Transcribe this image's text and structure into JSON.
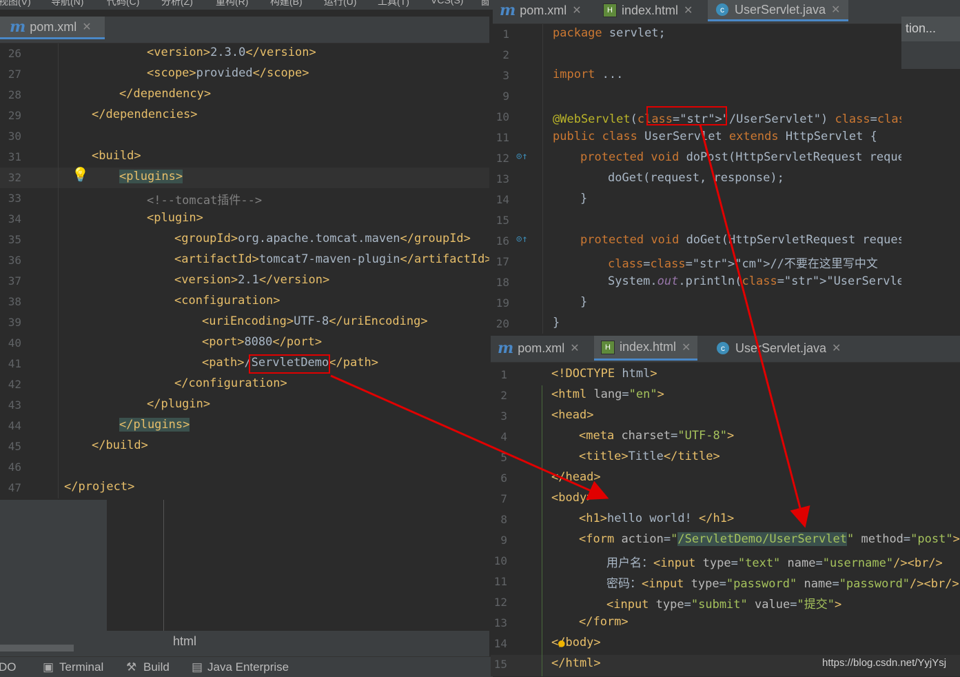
{
  "menu": {
    "items": [
      "视图(V)",
      "导航(N)",
      "代码(C)",
      "分析(Z)",
      "重构(R)",
      "构建(B)",
      "运行(U)",
      "工具(T)",
      "VCS(S)",
      "窗"
    ]
  },
  "left_editor": {
    "tab_label": "pom.xml",
    "gutter_numbers": [
      "26",
      "27",
      "28",
      "29",
      "30",
      "31",
      "32",
      "33",
      "34",
      "35",
      "36",
      "37",
      "38",
      "39",
      "40",
      "41",
      "42",
      "43",
      "44",
      "45",
      "46",
      "47"
    ],
    "lines": [
      "<version>2.3.0</version>",
      "<scope>provided</scope>",
      "</dependency>",
      "</dependencies>",
      "",
      "<build>",
      "<plugins>",
      "<!--tomcat插件-->",
      "<plugin>",
      "<groupId>org.apache.tomcat.maven</groupId>",
      "<artifactId>tomcat7-maven-plugin</artifactId>",
      "<version>2.1</version>",
      "<configuration>",
      "<uriEncoding>UTF-8</uriEncoding>",
      "<port>8080</port>",
      "<path>/ServletDemo</path>",
      "</configuration>",
      "</plugin>",
      "</plugins>",
      "</build>",
      "",
      "</project>"
    ],
    "panel_label": "html"
  },
  "top_right_editor": {
    "tabs": [
      "pom.xml",
      "index.html",
      "UserServlet.java"
    ],
    "active_tab": "UserServlet.java",
    "side_label": "tion...",
    "gutter_numbers": [
      "1",
      "2",
      "3",
      "9",
      "10",
      "11",
      "12",
      "13",
      "14",
      "15",
      "16",
      "17",
      "18",
      "19",
      "20"
    ],
    "lines": [
      "package servlet;",
      "",
      "import ...",
      "",
      "@WebServlet(\"/UserServlet\") //让前台页面访问的路径",
      "public class UserServlet extends HttpServlet {",
      "protected void doPost(HttpServletRequest reques",
      "doGet(request, response);",
      "}",
      "",
      "protected void doGet(HttpServletRequest request",
      "//不要在这里写中文",
      "System.out.println(\"UserServlet......\");",
      "}",
      "}"
    ]
  },
  "bottom_right_editor": {
    "tabs": [
      "pom.xml",
      "index.html",
      "UserServlet.java"
    ],
    "active_tab": "index.html",
    "gutter_numbers": [
      "1",
      "2",
      "3",
      "4",
      "5",
      "6",
      "7",
      "8",
      "9",
      "10",
      "11",
      "12",
      "13",
      "14",
      "15"
    ],
    "lines": [
      "<!DOCTYPE html>",
      "<html lang=\"en\">",
      "<head>",
      "<meta charset=\"UTF-8\">",
      "<title>Title</title>",
      "</head>",
      "<body>",
      "<h1>hello world! </h1>",
      "<form action=\"/ServletDemo/UserServlet\" method=\"post\">",
      "用户名：<input type=\"text\" name=\"username\"/><br/>",
      "密码：<input type=\"password\" name=\"password\"/><br/>",
      "<input type=\"submit\" value=\"提交\">",
      "</form>",
      "</body>",
      "</html>"
    ]
  },
  "toolbar": {
    "items": [
      "DO",
      "Terminal",
      "Build",
      "Java Enterprise"
    ]
  },
  "watermark": "https://blog.csdn.net/YyjYsj",
  "colors": {
    "annotation_red": "#e00000",
    "editor_bg": "#2b2b2b",
    "tab_accent": "#4a88c7"
  }
}
